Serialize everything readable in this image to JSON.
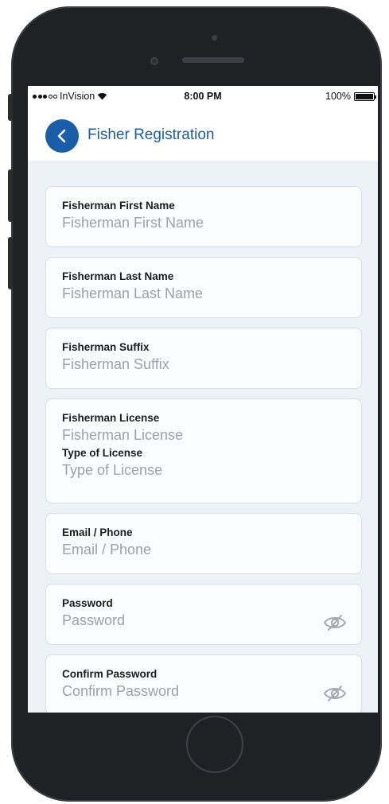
{
  "status_bar": {
    "carrier": "InVision",
    "time": "8:00 PM",
    "battery": "100%",
    "battery_level": 1.0,
    "signal_dots_filled": 3,
    "signal_dots_total": 5
  },
  "header": {
    "title": "Fisher Registration"
  },
  "form": {
    "first_name": {
      "label": "Fisherman First Name",
      "placeholder": "Fisherman First Name"
    },
    "last_name": {
      "label": "Fisherman Last Name",
      "placeholder": "Fisherman Last Name"
    },
    "suffix": {
      "label": "Fisherman Suffix",
      "placeholder": "Fisherman Suffix"
    },
    "license": {
      "label": "Fisherman License",
      "placeholder": "Fisherman License"
    },
    "license_type": {
      "label": "Type of License",
      "placeholder": "Type of License"
    },
    "email_phone": {
      "label": "Email / Phone",
      "placeholder": "Email / Phone"
    },
    "password": {
      "label": "Password",
      "placeholder": "Password"
    },
    "confirm_password": {
      "label": "Confirm Password",
      "placeholder": "Confirm Password"
    }
  },
  "colors": {
    "accent": "#1a5da8",
    "screen_bg": "#edf2f8",
    "card_bg": "#fbfcfe",
    "placeholder": "#9aa1a9",
    "phone_body": "#1f2125"
  },
  "icons": {
    "back": "chevron-left-icon",
    "password_toggle": "eye-slash-icon",
    "wifi": "wifi-icon",
    "battery": "battery-icon"
  }
}
